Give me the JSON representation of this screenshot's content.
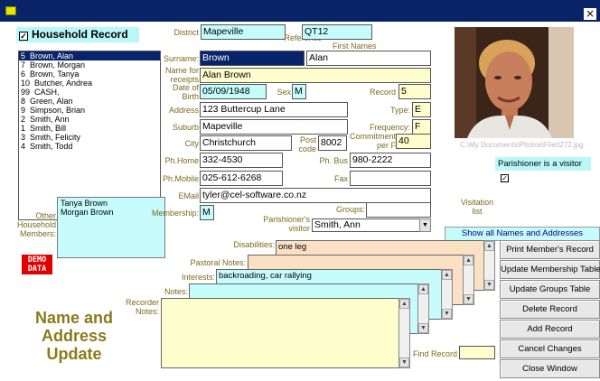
{
  "window": {
    "close": "×"
  },
  "household": {
    "checkbox_mark": "✓",
    "label": "Household Record"
  },
  "names": [
    "5  Brown, Alan",
    "7  Brown, Morgan",
    "6  Brown, Tanya",
    "10  Butcher, Andrea",
    "99  CASH,",
    "8  Green, Alan",
    "9  Simpson, Brian",
    "2  Smith, Ann",
    "1  Smith, Bill",
    "3  Smith, Felicity",
    "4  Smith, Todd"
  ],
  "other_members": {
    "label": "Other Household Members:",
    "values": [
      "Tanya Brown",
      "Morgan Brown"
    ]
  },
  "demo": {
    "line1": "DEMO",
    "line2": "DATA"
  },
  "screen_title": {
    "line1": "Name and",
    "line2": "Address",
    "line3": "Update"
  },
  "fields": {
    "district": {
      "label": "District",
      "value": "Mapeville"
    },
    "map_ref": {
      "label": "Map Reference",
      "value": "QT12"
    },
    "first_names_label": "First Names",
    "surname": {
      "label": "Surname:",
      "value": "Brown"
    },
    "first_names": {
      "value": "Alan"
    },
    "name_for_receipts": {
      "label": "Name for receipts",
      "value": "Alan Brown"
    },
    "dob": {
      "label": "Date of Birth",
      "value": "05/09/1948"
    },
    "sex": {
      "label": "Sex",
      "value": "M"
    },
    "record": {
      "label": "Record",
      "value": "5"
    },
    "address": {
      "label": "Address",
      "value": "123 Buttercup Lane"
    },
    "type": {
      "label": "Type:",
      "value": "E"
    },
    "suburb": {
      "label": "Suburb",
      "value": "Mapeville"
    },
    "frequency": {
      "label": "Frequency:",
      "value": "F"
    },
    "city": {
      "label": "City",
      "value": "Christchurch"
    },
    "post_code": {
      "label": "Post code",
      "value": "8002"
    },
    "commitment": {
      "label": "Commitment per F",
      "value": "40"
    },
    "ph_home": {
      "label": "Ph.Home",
      "value": "332-4530"
    },
    "ph_bus": {
      "label": "Ph. Bus",
      "value": "980-2222"
    },
    "ph_mobile": {
      "label": "Ph.Mobile",
      "value": "025-612-6268"
    },
    "fax": {
      "label": "Fax",
      "value": ""
    },
    "email": {
      "label": "EMail",
      "value": "tyler@cel-software.co.nz"
    },
    "membership": {
      "label": "Membership:",
      "value": "M"
    },
    "groups": {
      "label": "Groups:",
      "value": ""
    },
    "parishioner_visitor": {
      "label": "Parishioner's visitor",
      "value": "Smith, Ann"
    },
    "visitation_list_label": "Visitation list",
    "disabilities": {
      "label": "Disabilities:",
      "value": "one leg"
    },
    "pastoral_notes": {
      "label": "Pastoral Notes:",
      "value": ""
    },
    "interests": {
      "label": "Interests:",
      "value": "backroading, car rallying"
    },
    "notes": {
      "label": "Notes:",
      "value": ""
    },
    "recorder_notes": {
      "label": "Recorder Notes:",
      "value": ""
    },
    "find_record": {
      "label": "Find Record",
      "value": ""
    }
  },
  "photo": {
    "caption": "C:\\My Documents\\Photos\\File0272.jpg"
  },
  "visitor": {
    "label": "Parishioner  is a visitor",
    "mark": "✓"
  },
  "show_all": "Show all Names and Addresses",
  "buttons": [
    "Print Member's Record",
    "Update Membership Table",
    "Update Groups Table",
    "Delete Record",
    "Add Record",
    "Cancel Changes",
    "Close Window"
  ],
  "colors": {
    "title_bar": "#082466",
    "label_text": "#7d6a1c",
    "cyan_field": "#c6fcfc",
    "yellow_field": "#fefecc",
    "demo_red": "#e10000"
  }
}
